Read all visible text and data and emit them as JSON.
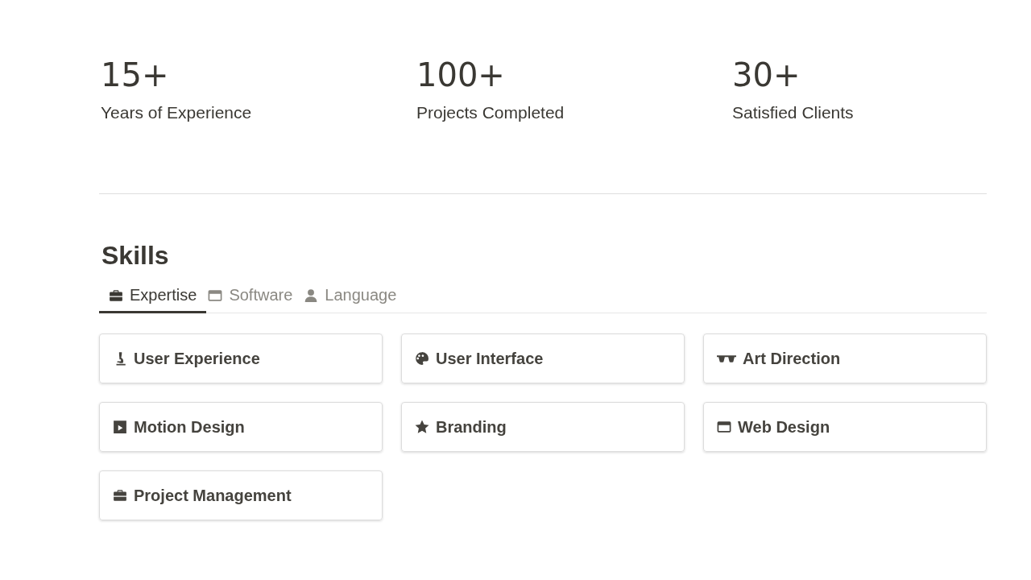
{
  "stats": [
    {
      "value": "15+",
      "label": "Years of Experience"
    },
    {
      "value": "100+",
      "label": "Projects Completed"
    },
    {
      "value": "30+",
      "label": "Satisfied Clients"
    }
  ],
  "skills": {
    "title": "Skills",
    "tabs": [
      {
        "label": "Expertise",
        "selected": true
      },
      {
        "label": "Software",
        "selected": false
      },
      {
        "label": "Language",
        "selected": false
      }
    ],
    "items": [
      "User Experience",
      "User Interface",
      "Art Direction",
      "Motion Design",
      "Branding",
      "Web Design",
      "Project Management"
    ]
  }
}
